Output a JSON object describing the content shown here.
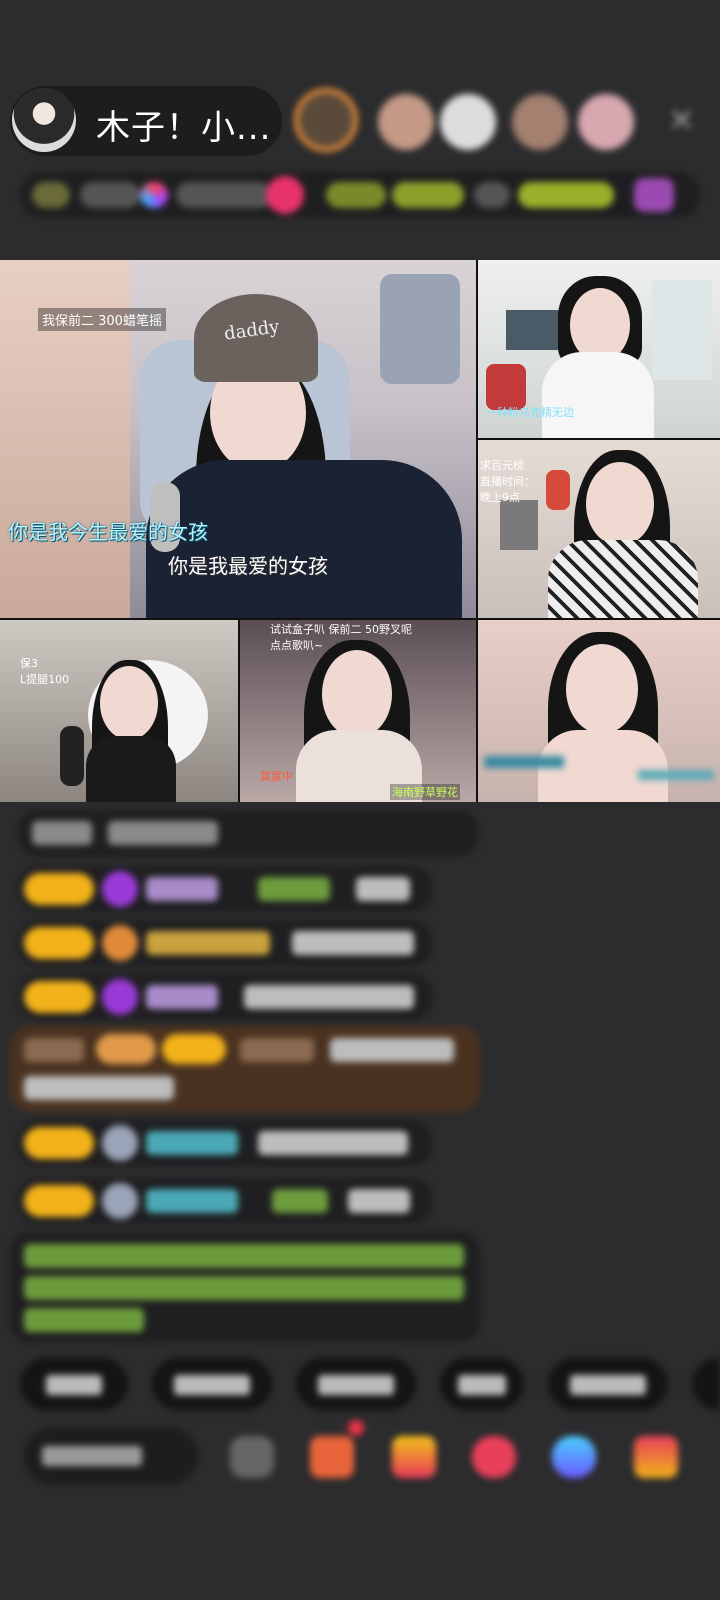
{
  "header": {
    "host_name": "木子！小...",
    "close_glyph": "✕"
  },
  "stream": {
    "main": {
      "top_caption": "我保前二 300蜡笔摇",
      "cap_text": "daddy",
      "lyric_line_1": "你是我今生最爱的女孩",
      "lyric_line_2": "你是我最爱的女孩"
    },
    "right_top": {
      "bottom_caption": "一种粉乌克精无边"
    },
    "right_mid": {
      "caption_lines": [
        "求百元榜",
        "直播时间：",
        "晚上9点"
      ]
    },
    "bottom_left": {
      "caption_lines": [
        "保3",
        "L提腿100"
      ]
    },
    "bottom_mid": {
      "caption_top": "试试盒子叭  保前二   50野叉呢",
      "caption_sub": "点点歌叭~",
      "caption_red": "寞寞中",
      "caption_bottom": "海南野草野花"
    }
  },
  "colors": {
    "background": "#2c2c2e",
    "badge": "#f2b21a",
    "chat_name_green": "#6d9c3d",
    "chat_name_purple": "#a88bc9",
    "chat_name_gold": "#c9a13e",
    "chat_name_cyan": "#4aa8b5",
    "lyric_cyan": "#bdf2ff"
  }
}
